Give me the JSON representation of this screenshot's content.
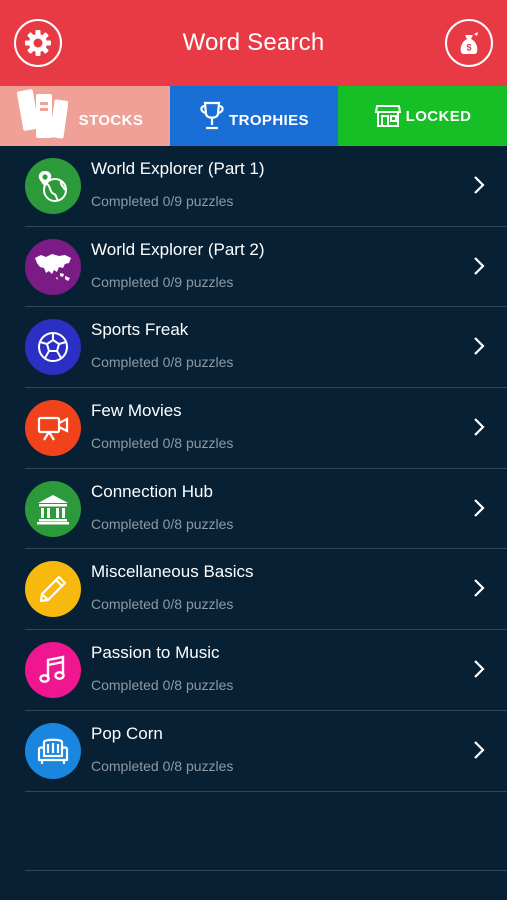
{
  "header": {
    "title": "Word Search",
    "left_icon": "gear-icon",
    "right_icon": "money-bag-icon",
    "color": "#e83a45"
  },
  "tabs": [
    {
      "label": "STOCKS",
      "icon": "books-icon",
      "color": "#f0a096"
    },
    {
      "label": "TROPHIES",
      "icon": "trophy-icon",
      "color": "#1a6fd6"
    },
    {
      "label": "LOCKED",
      "icon": "store-icon",
      "color": "#16bf25"
    }
  ],
  "categories": [
    {
      "title": "World Explorer (Part 1)",
      "status": "Completed 0/9 puzzles",
      "icon": "globe-pin-icon",
      "color": "#2c9a3a"
    },
    {
      "title": "World Explorer (Part 2)",
      "status": "Completed 0/9 puzzles",
      "icon": "asia-map-icon",
      "color": "#7b1c86"
    },
    {
      "title": "Sports Freak",
      "status": "Completed 0/8 puzzles",
      "icon": "soccer-ball-icon",
      "color": "#2b2fc4"
    },
    {
      "title": "Few Movies",
      "status": "Completed 0/8 puzzles",
      "icon": "video-camera-icon",
      "color": "#f1431b"
    },
    {
      "title": "Connection Hub",
      "status": "Completed 0/8 puzzles",
      "icon": "bank-icon",
      "color": "#2c9a3a"
    },
    {
      "title": "Miscellaneous Basics",
      "status": "Completed 0/8 puzzles",
      "icon": "pencil-icon",
      "color": "#f7b90d"
    },
    {
      "title": "Passion to Music",
      "status": "Completed 0/8 puzzles",
      "icon": "music-note-icon",
      "color": "#f0168f"
    },
    {
      "title": "Pop Corn",
      "status": "Completed 0/8 puzzles",
      "icon": "armchair-icon",
      "color": "#1a86e0"
    }
  ],
  "colors": {
    "background": "#082033",
    "divider": "#2f4657",
    "subtext": "#8d9aa5"
  }
}
